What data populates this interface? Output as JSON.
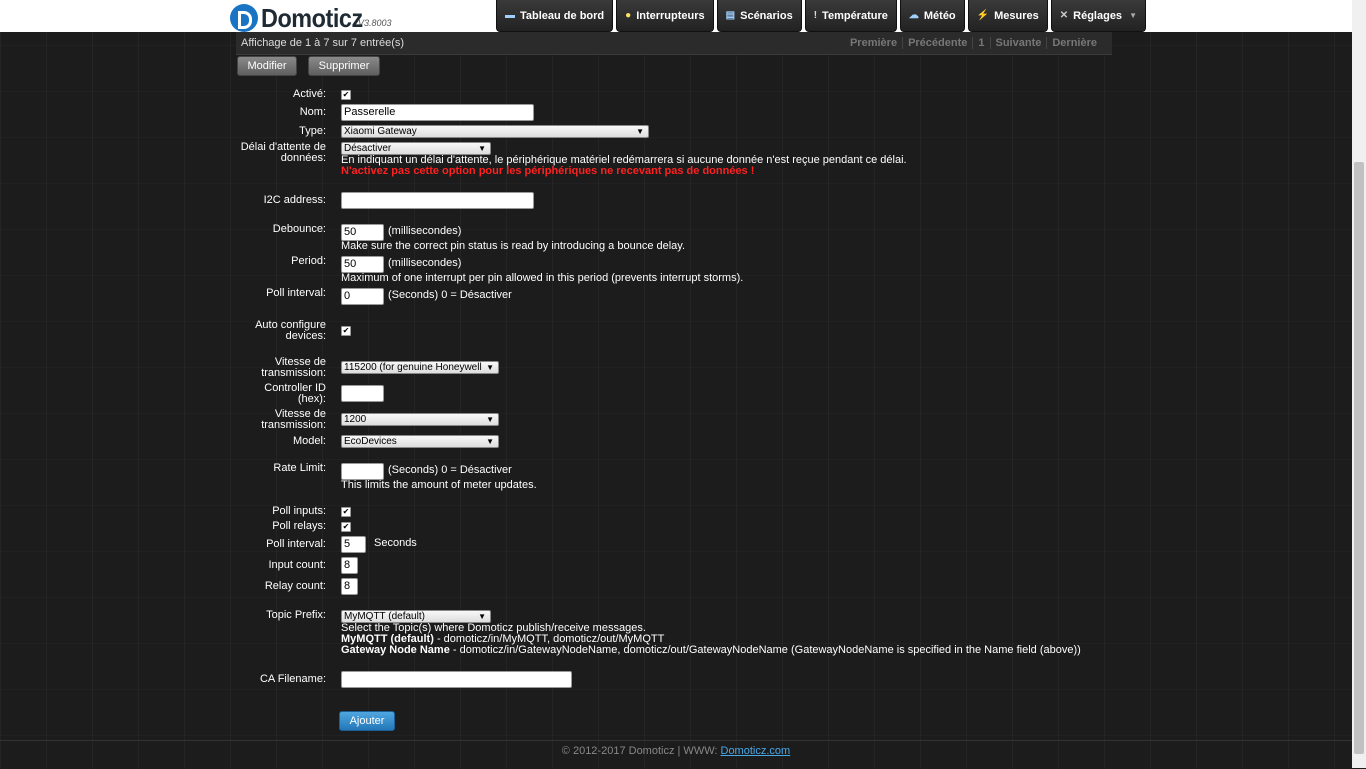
{
  "header": {
    "logo_text": "Domoticz",
    "version": "V3.8003",
    "nav": [
      {
        "label": "Tableau de bord",
        "icon": "dashboard-icon"
      },
      {
        "label": "Interrupteurs",
        "icon": "lightbulb-icon"
      },
      {
        "label": "Scénarios",
        "icon": "scenes-icon"
      },
      {
        "label": "Température",
        "icon": "thermometer-icon"
      },
      {
        "label": "Météo",
        "icon": "weather-icon"
      },
      {
        "label": "Mesures",
        "icon": "meter-icon"
      },
      {
        "label": "Réglages",
        "icon": "tools-icon"
      }
    ]
  },
  "table": {
    "info": "Affichage de 1 à 7 sur 7 entrée(s)",
    "pager": [
      "Première",
      "Précédente",
      "1",
      "Suivante",
      "Dernière"
    ],
    "modify_label": "Modifier",
    "delete_label": "Supprimer"
  },
  "form": {
    "enabled_label": "Activé:",
    "name_label": "Nom:",
    "name_value": "Passerelle",
    "type_label": "Type:",
    "type_value": "Xiaomi Gateway",
    "timeout_label_1": "Délai d'attente de",
    "timeout_label_2": "données:",
    "timeout_value": "Désactiver",
    "timeout_help": "En indiquant un délai d'attente, le périphérique matériel redémarrera si aucune donnée n'est reçue pendant ce délai.",
    "timeout_warning": "N'activez pas cette option pour les périphériques ne recevant pas de données !",
    "i2c_label": "I2C address:",
    "i2c_value": "",
    "debounce_label": "Debounce:",
    "debounce_value": "50",
    "ms_unit": "(millisecondes)",
    "debounce_help": "Make sure the correct pin status is read by introducing a bounce delay.",
    "period_label": "Period:",
    "period_value": "50",
    "period_help": "Maximum of one interrupt per pin allowed in this period (prevents interrupt storms).",
    "poll_interval_label": "Poll interval:",
    "poll_interval_value": "0",
    "seconds_disable_unit": "(Seconds) 0 = Désactiver",
    "autoconf_label_1": "Auto configure",
    "autoconf_label_2": "devices:",
    "baud_label_1": "Vitesse de",
    "baud_label_2": "transmission:",
    "baud_value": "115200 (for genuine Honeywell",
    "controller_label_1": "Controller ID",
    "controller_label_2": "(hex):",
    "controller_value": "",
    "baud2_value": "1200",
    "model_label": "Model:",
    "model_value": "EcoDevices",
    "rate_label": "Rate Limit:",
    "rate_value": "",
    "rate_help": "This limits the amount of meter updates.",
    "poll_inputs_label": "Poll inputs:",
    "poll_relays_label": "Poll relays:",
    "poll_interval2_value": "5",
    "seconds_unit": "Seconds",
    "input_count_label": "Input count:",
    "input_count_value": "8",
    "relay_count_label": "Relay count:",
    "relay_count_value": "8",
    "topic_label": "Topic Prefix:",
    "topic_value": "MyMQTT (default)",
    "topic_help": "Select the Topic(s) where Domoticz publish/receive messages.",
    "topic_opt1_name": "MyMQTT (default)",
    "topic_opt1_desc": " - domoticz/in/MyMQTT, domoticz/out/MyMQTT",
    "topic_opt2_name": "Gateway Node Name",
    "topic_opt2_desc": " - domoticz/in/GatewayNodeName, domoticz/out/GatewayNodeName (GatewayNodeName is specified in the Name field (above))",
    "ca_label": "CA Filename:",
    "ca_value": "",
    "add_label": "Ajouter"
  },
  "footer": {
    "copyright": "© 2012-2017 Domoticz | WWW: ",
    "link": "Domoticz.com"
  },
  "colors": {
    "accent": "#2377b8",
    "warning": "#ff2020",
    "link": "#4aa8e8"
  }
}
